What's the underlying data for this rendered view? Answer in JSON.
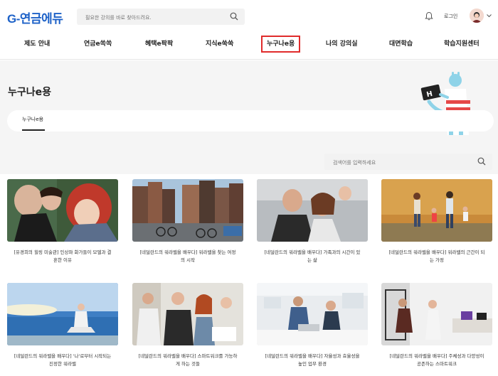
{
  "header": {
    "logo": "G-연금에듀",
    "search_placeholder": "필요한 강의를 바로 찾아드려요.",
    "login": "로그인"
  },
  "nav": [
    {
      "label": "제도 안내"
    },
    {
      "label": "연금e쏙쏙"
    },
    {
      "label": "혜택e팍팍"
    },
    {
      "label": "지식e쑥쑥"
    },
    {
      "label": "누구나e용"
    },
    {
      "label": "나의 강의실"
    },
    {
      "label": "대면학습"
    },
    {
      "label": "학습지원센터"
    }
  ],
  "page": {
    "title": "누구나e용",
    "tab": "누구나e용"
  },
  "content_search": {
    "placeholder": "검색어를 입력하세요"
  },
  "cards": [
    {
      "title": "[유경희의 힐링 미술관] 인상파 화가들이 모델과 결혼한 이유"
    },
    {
      "title": "[네덜란드의 워라밸을 배우다] 워라밸을 찾는 여정의 시작"
    },
    {
      "title": "[네덜란드의 워라밸을 배우다] 가족과의 시간이 있는 삶"
    },
    {
      "title": "[네덜란드의 워라밸을 배우다] 워라밸의 근간이 되는 가정"
    },
    {
      "title": "[네덜란드의 워라밸을 배우다] '나'로부터 시작되는 진정한 워라밸"
    },
    {
      "title": "[네덜란드의 워라밸을 배우다] 스마트워크를 가능하게 하는 것들"
    },
    {
      "title": "[네덜란드의 워라밸을 배우다] 자율성과 효율성을 높인 업무 환경"
    },
    {
      "title": "[네덜란드의 워라밸을 배우다] 주체성과 다양성이 공존하는 스마트워크"
    }
  ],
  "colors": {
    "brand": "#1e62c8",
    "active_outline": "#e02b2b"
  }
}
